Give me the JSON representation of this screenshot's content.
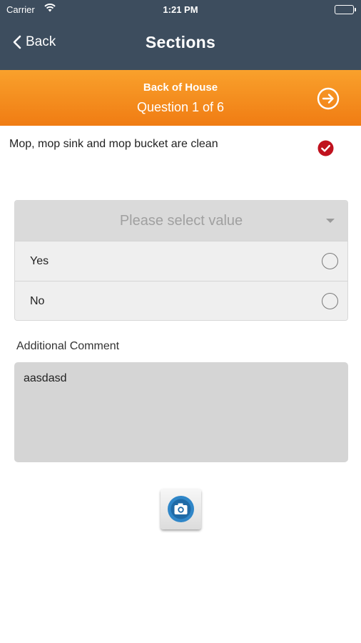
{
  "status_bar": {
    "carrier": "Carrier",
    "time": "1:21 PM"
  },
  "nav": {
    "back_label": "Back",
    "title": "Sections"
  },
  "question_header": {
    "section": "Back of House",
    "progress": "Question 1 of 6"
  },
  "question": {
    "text": "Mop, mop sink and mop bucket are clean",
    "answered": true
  },
  "select": {
    "placeholder": "Please select value",
    "options": [
      {
        "label": "Yes",
        "selected": false
      },
      {
        "label": "No",
        "selected": false
      }
    ]
  },
  "comment": {
    "label": "Additional Comment",
    "value": "aasdasd"
  },
  "colors": {
    "nav_bg": "#3d4d5e",
    "accent_orange": "#f39120",
    "check_red": "#c0121e",
    "camera_blue": "#2f86c8"
  },
  "icons": {
    "back": "chevron-left-icon",
    "next": "arrow-right-circle-icon",
    "check": "check-circle-icon",
    "camera": "camera-icon"
  }
}
